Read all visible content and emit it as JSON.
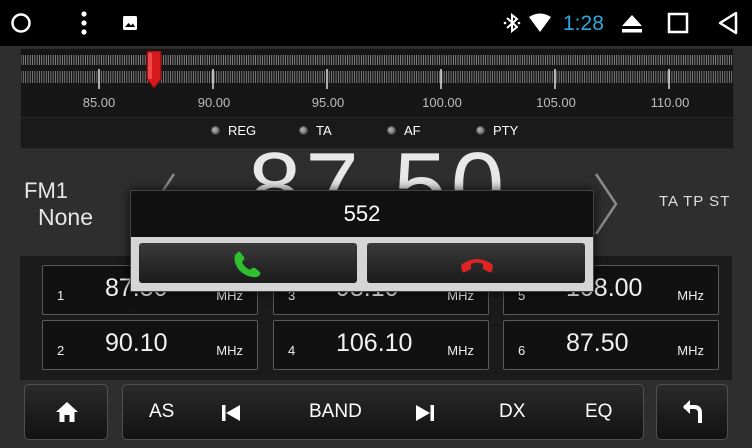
{
  "status": {
    "time": "1:28",
    "icons": [
      "circle-home-icon",
      "overflow-menu-icon",
      "image-notification-icon",
      "bluetooth-icon",
      "wifi-icon",
      "eject-icon",
      "recent-apps-icon",
      "back-icon"
    ],
    "accent": "#2aa8e0"
  },
  "tuner": {
    "scale": [
      "85.00",
      "90.00",
      "95.00",
      "100.00",
      "105.00",
      "110.00"
    ],
    "indicators": [
      "REG",
      "TA",
      "AF",
      "PTY"
    ],
    "needle_color": "#d8191c"
  },
  "radio": {
    "band": "FM1",
    "ps_name": "None",
    "frequency": "87.50",
    "flags": "TA TP ST"
  },
  "presets": [
    {
      "num": "1",
      "freq": "87.50",
      "unit": "MHz"
    },
    {
      "num": "3",
      "freq": "98.10",
      "unit": "MHz"
    },
    {
      "num": "5",
      "freq": "108.00",
      "unit": "MHz"
    },
    {
      "num": "2",
      "freq": "90.10",
      "unit": "MHz"
    },
    {
      "num": "4",
      "freq": "106.10",
      "unit": "MHz"
    },
    {
      "num": "6",
      "freq": "87.50",
      "unit": "MHz"
    }
  ],
  "controls": {
    "as": "AS",
    "band": "BAND",
    "dx": "DX",
    "eq": "EQ"
  },
  "call": {
    "number": "552",
    "answer_color": "#2fbf2f",
    "hangup_color": "#e02424"
  }
}
